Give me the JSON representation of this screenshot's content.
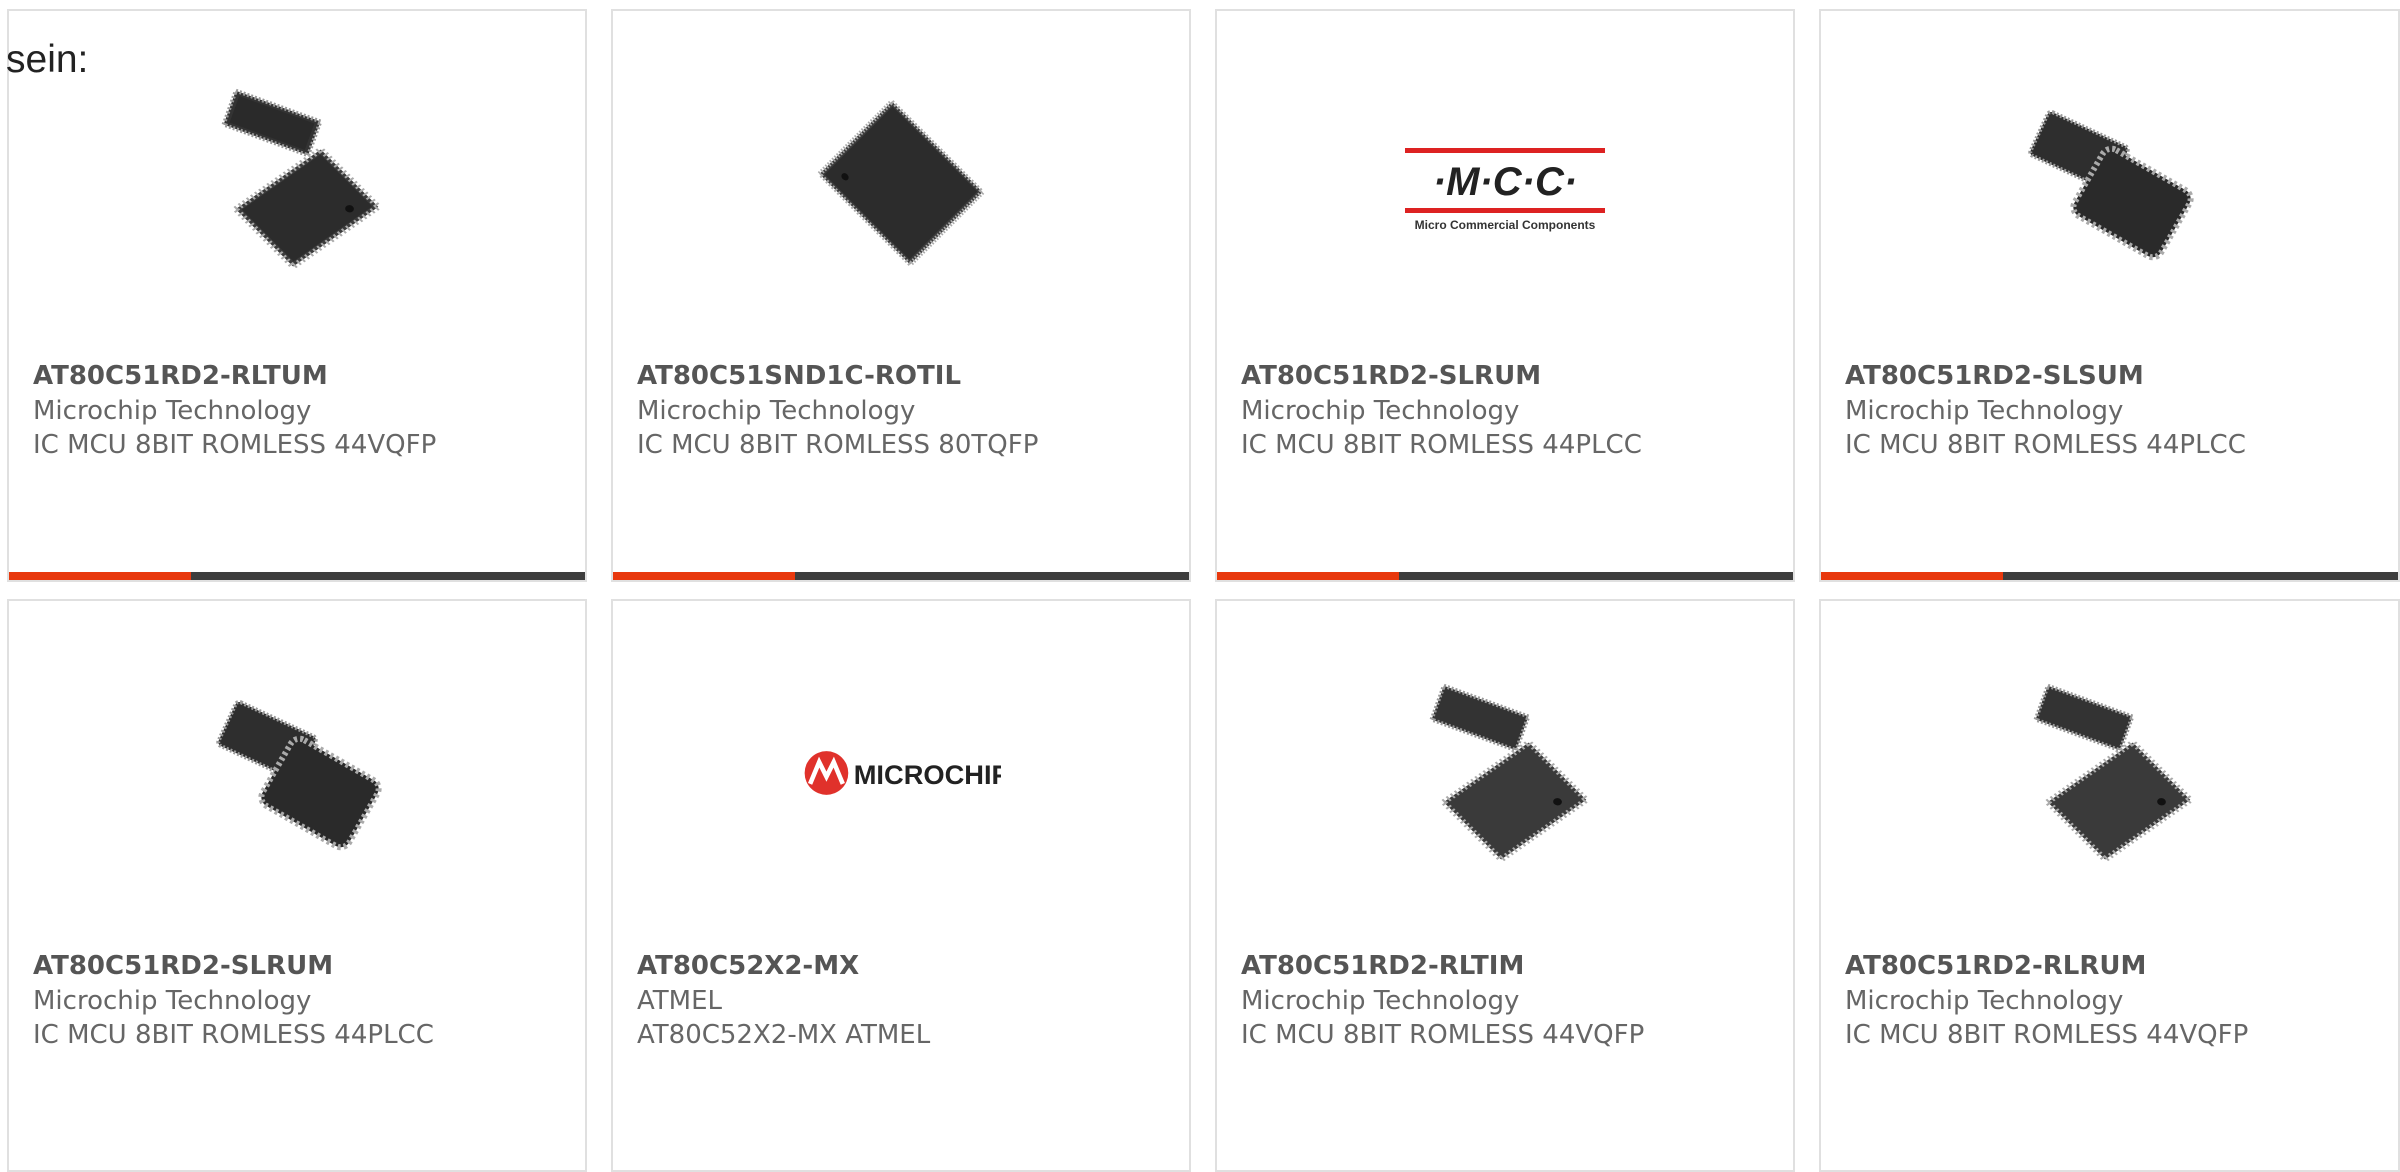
{
  "intro_text": "sein:",
  "accent_color": "#e8380d",
  "bar_color": "#3d3d3d",
  "products": [
    {
      "part": "AT80C51RD2-RLTUM",
      "manufacturer": "Microchip Technology",
      "description": "IC MCU 8BIT ROMLESS 44VQFP",
      "image": "vqfp-two-chips"
    },
    {
      "part": "AT80C51SND1C-ROTIL",
      "manufacturer": "Microchip Technology",
      "description": "IC MCU 8BIT ROMLESS 80TQFP",
      "image": "tqfp-chip"
    },
    {
      "part": "AT80C51RD2-SLRUM",
      "manufacturer": "Microchip Technology",
      "description": "IC MCU 8BIT ROMLESS 44PLCC",
      "image": "mcc-logo",
      "logo_text": "·M·C·C·",
      "logo_subtext": "Micro Commercial Components"
    },
    {
      "part": "AT80C51RD2-SLSUM",
      "manufacturer": "Microchip Technology",
      "description": "IC MCU 8BIT ROMLESS 44PLCC",
      "image": "plcc-two-chips"
    },
    {
      "part": "AT80C51RD2-SLRUM",
      "manufacturer": "Microchip Technology",
      "description": "IC MCU 8BIT ROMLESS 44PLCC",
      "image": "plcc-two-chips"
    },
    {
      "part": "AT80C52X2-MX",
      "manufacturer": "ATMEL",
      "description": "AT80C52X2-MX ATMEL",
      "image": "microchip-logo",
      "logo_text": "MICROCHIP"
    },
    {
      "part": "AT80C51RD2-RLTIM",
      "manufacturer": "Microchip Technology",
      "description": "IC MCU 8BIT ROMLESS 44VQFP",
      "image": "vqfp-two-chips"
    },
    {
      "part": "AT80C51RD2-RLRUM",
      "manufacturer": "Microchip Technology",
      "description": "IC MCU 8BIT ROMLESS 44VQFP",
      "image": "vqfp-two-chips"
    }
  ]
}
